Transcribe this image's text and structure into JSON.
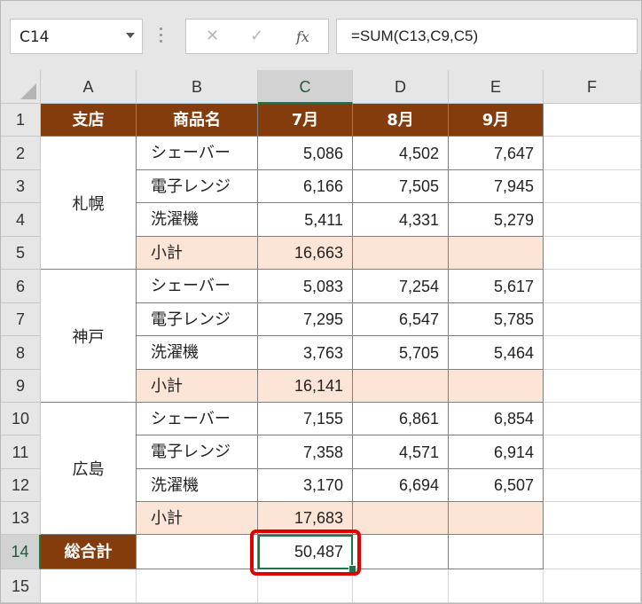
{
  "formula_bar": {
    "name_box": "C14",
    "cancel_icon": "✕",
    "enter_icon": "✓",
    "fx_label": "fx",
    "formula": "=SUM(C13,C9,C5)"
  },
  "columns": [
    "A",
    "B",
    "C",
    "D",
    "E",
    "F"
  ],
  "rows": [
    "1",
    "2",
    "3",
    "4",
    "5",
    "6",
    "7",
    "8",
    "9",
    "10",
    "11",
    "12",
    "13",
    "14",
    "15"
  ],
  "header_row": [
    "支店",
    "商品名",
    "7月",
    "8月",
    "9月"
  ],
  "branches": [
    "札幌",
    "神戸",
    "広島"
  ],
  "table": [
    [
      "シェーバー",
      "5,086",
      "4,502",
      "7,647"
    ],
    [
      "電子レンジ",
      "6,166",
      "7,505",
      "7,945"
    ],
    [
      "洗濯機",
      "5,411",
      "4,331",
      "5,279"
    ],
    [
      "小計",
      "16,663",
      "",
      ""
    ],
    [
      "シェーバー",
      "5,083",
      "7,254",
      "5,617"
    ],
    [
      "電子レンジ",
      "7,295",
      "6,547",
      "5,785"
    ],
    [
      "洗濯機",
      "3,763",
      "5,705",
      "5,464"
    ],
    [
      "小計",
      "16,141",
      "",
      ""
    ],
    [
      "シェーバー",
      "7,155",
      "6,861",
      "6,854"
    ],
    [
      "電子レンジ",
      "7,358",
      "4,571",
      "6,914"
    ],
    [
      "洗濯機",
      "3,170",
      "6,694",
      "6,507"
    ],
    [
      "小計",
      "17,683",
      "",
      ""
    ]
  ],
  "total_row": {
    "label": "総合計",
    "value": "50,487"
  },
  "colors": {
    "header_fill": "#843c0c",
    "subtotal_fill": "#fce4d6",
    "selection": "#217346",
    "highlight": "#e00000"
  }
}
